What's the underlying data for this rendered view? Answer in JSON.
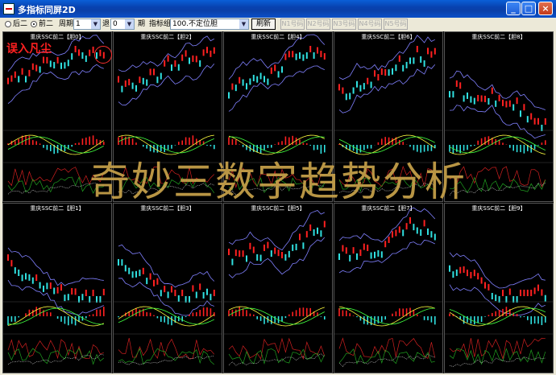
{
  "window": {
    "title": "多指标同屏2D"
  },
  "toolbar": {
    "radio_after": "后二",
    "radio_front": "前二",
    "period_label": "周期",
    "period_value": "1",
    "back_label": "退",
    "back_value": "0",
    "period_unit": "期",
    "indicator_label": "指标组",
    "indicator_value": "100.不定位胆",
    "refresh_label": "刷新",
    "groups": [
      "N1号码",
      "N2号码",
      "N3号码",
      "N4号码",
      "N5号码"
    ]
  },
  "panels": [
    {
      "title": "重庆SSC前二【胆0】"
    },
    {
      "title": "重庆SSC前二【胆2】"
    },
    {
      "title": "重庆SSC前二【胆4】"
    },
    {
      "title": "重庆SSC前二【胆6】"
    },
    {
      "title": "重庆SSC前二【胆8】"
    },
    {
      "title": "重庆SSC前二【胆1】"
    },
    {
      "title": "重庆SSC前二【胆3】"
    },
    {
      "title": "重庆SSC前二【胆5】"
    },
    {
      "title": "重庆SSC前二【胆7】"
    },
    {
      "title": "重庆SSC前二【胆9】"
    }
  ],
  "overlay": {
    "watermark": "奇妙三数字趋势分析",
    "annotation": "误入凡尘"
  },
  "colors": {
    "up": "#ff2020",
    "down": "#30e0e0",
    "band": "#8080ff",
    "macd_line": "#ffff40",
    "green_line": "#40ff40"
  }
}
